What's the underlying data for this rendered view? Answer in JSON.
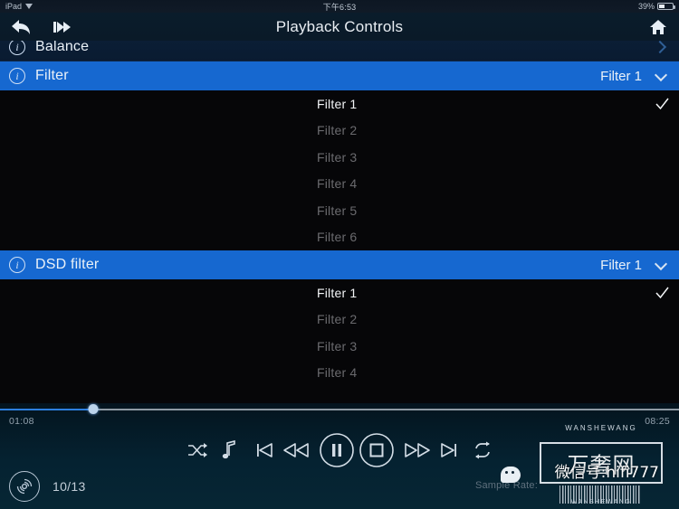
{
  "status_bar": {
    "carrier": "iPad",
    "wifi_icon": "wifi-icon",
    "time": "下午6:53",
    "battery_percent": "39%",
    "battery_icon": "battery-icon"
  },
  "nav": {
    "back_icon": "back-arrow-icon",
    "forward_icon": "fast-forward-page-icon",
    "title": "Playback Controls",
    "home_icon": "home-icon"
  },
  "settings": {
    "balance": {
      "info_icon": "info-icon",
      "info_glyph": "i",
      "label": "Balance",
      "chevron": "chevron-right-icon"
    },
    "filter": {
      "info_icon": "info-icon",
      "info_glyph": "i",
      "label": "Filter",
      "value": "Filter 1",
      "chevron": "chevron-down-icon",
      "options": [
        {
          "label": "Filter 1",
          "selected": true
        },
        {
          "label": "Filter 2",
          "selected": false
        },
        {
          "label": "Filter 3",
          "selected": false
        },
        {
          "label": "Filter 4",
          "selected": false
        },
        {
          "label": "Filter 5",
          "selected": false
        },
        {
          "label": "Filter 6",
          "selected": false
        }
      ]
    },
    "dsd_filter": {
      "info_icon": "info-icon",
      "info_glyph": "i",
      "label": "DSD filter",
      "value": "Filter 1",
      "chevron": "chevron-down-icon",
      "options": [
        {
          "label": "Filter 1",
          "selected": true
        },
        {
          "label": "Filter 2",
          "selected": false
        },
        {
          "label": "Filter 3",
          "selected": false
        },
        {
          "label": "Filter 4",
          "selected": false
        }
      ]
    }
  },
  "player": {
    "elapsed": "01:08",
    "remaining": "08:25",
    "progress_percent": 13.7,
    "transport": [
      {
        "name": "shuffle-button",
        "icon": "shuffle-icon"
      },
      {
        "name": "music-note-button",
        "icon": "music-note-icon"
      },
      {
        "name": "previous-track-button",
        "icon": "previous-track-icon"
      },
      {
        "name": "rewind-button",
        "icon": "rewind-icon"
      },
      {
        "name": "pause-button",
        "icon": "pause-icon"
      },
      {
        "name": "stop-button",
        "icon": "stop-icon"
      },
      {
        "name": "fast-forward-button",
        "icon": "fast-forward-icon"
      },
      {
        "name": "next-track-button",
        "icon": "next-track-icon"
      },
      {
        "name": "repeat-button",
        "icon": "repeat-icon"
      }
    ],
    "disc_icon": "vinyl-disc-icon",
    "track_count": "10/13",
    "sample_rate_label": "Sample Rate:"
  },
  "watermark": {
    "brand_cn": "万奢网",
    "arc_top": "WANSHEWANG",
    "arc_bottom": "WANSHEWANG",
    "wechat": "微信号:hifi777"
  },
  "colors": {
    "accent_blue": "#1668d0",
    "progress_blue": "#2d7fe0",
    "list_bg": "#060608",
    "bottom_bar": "#052231"
  }
}
